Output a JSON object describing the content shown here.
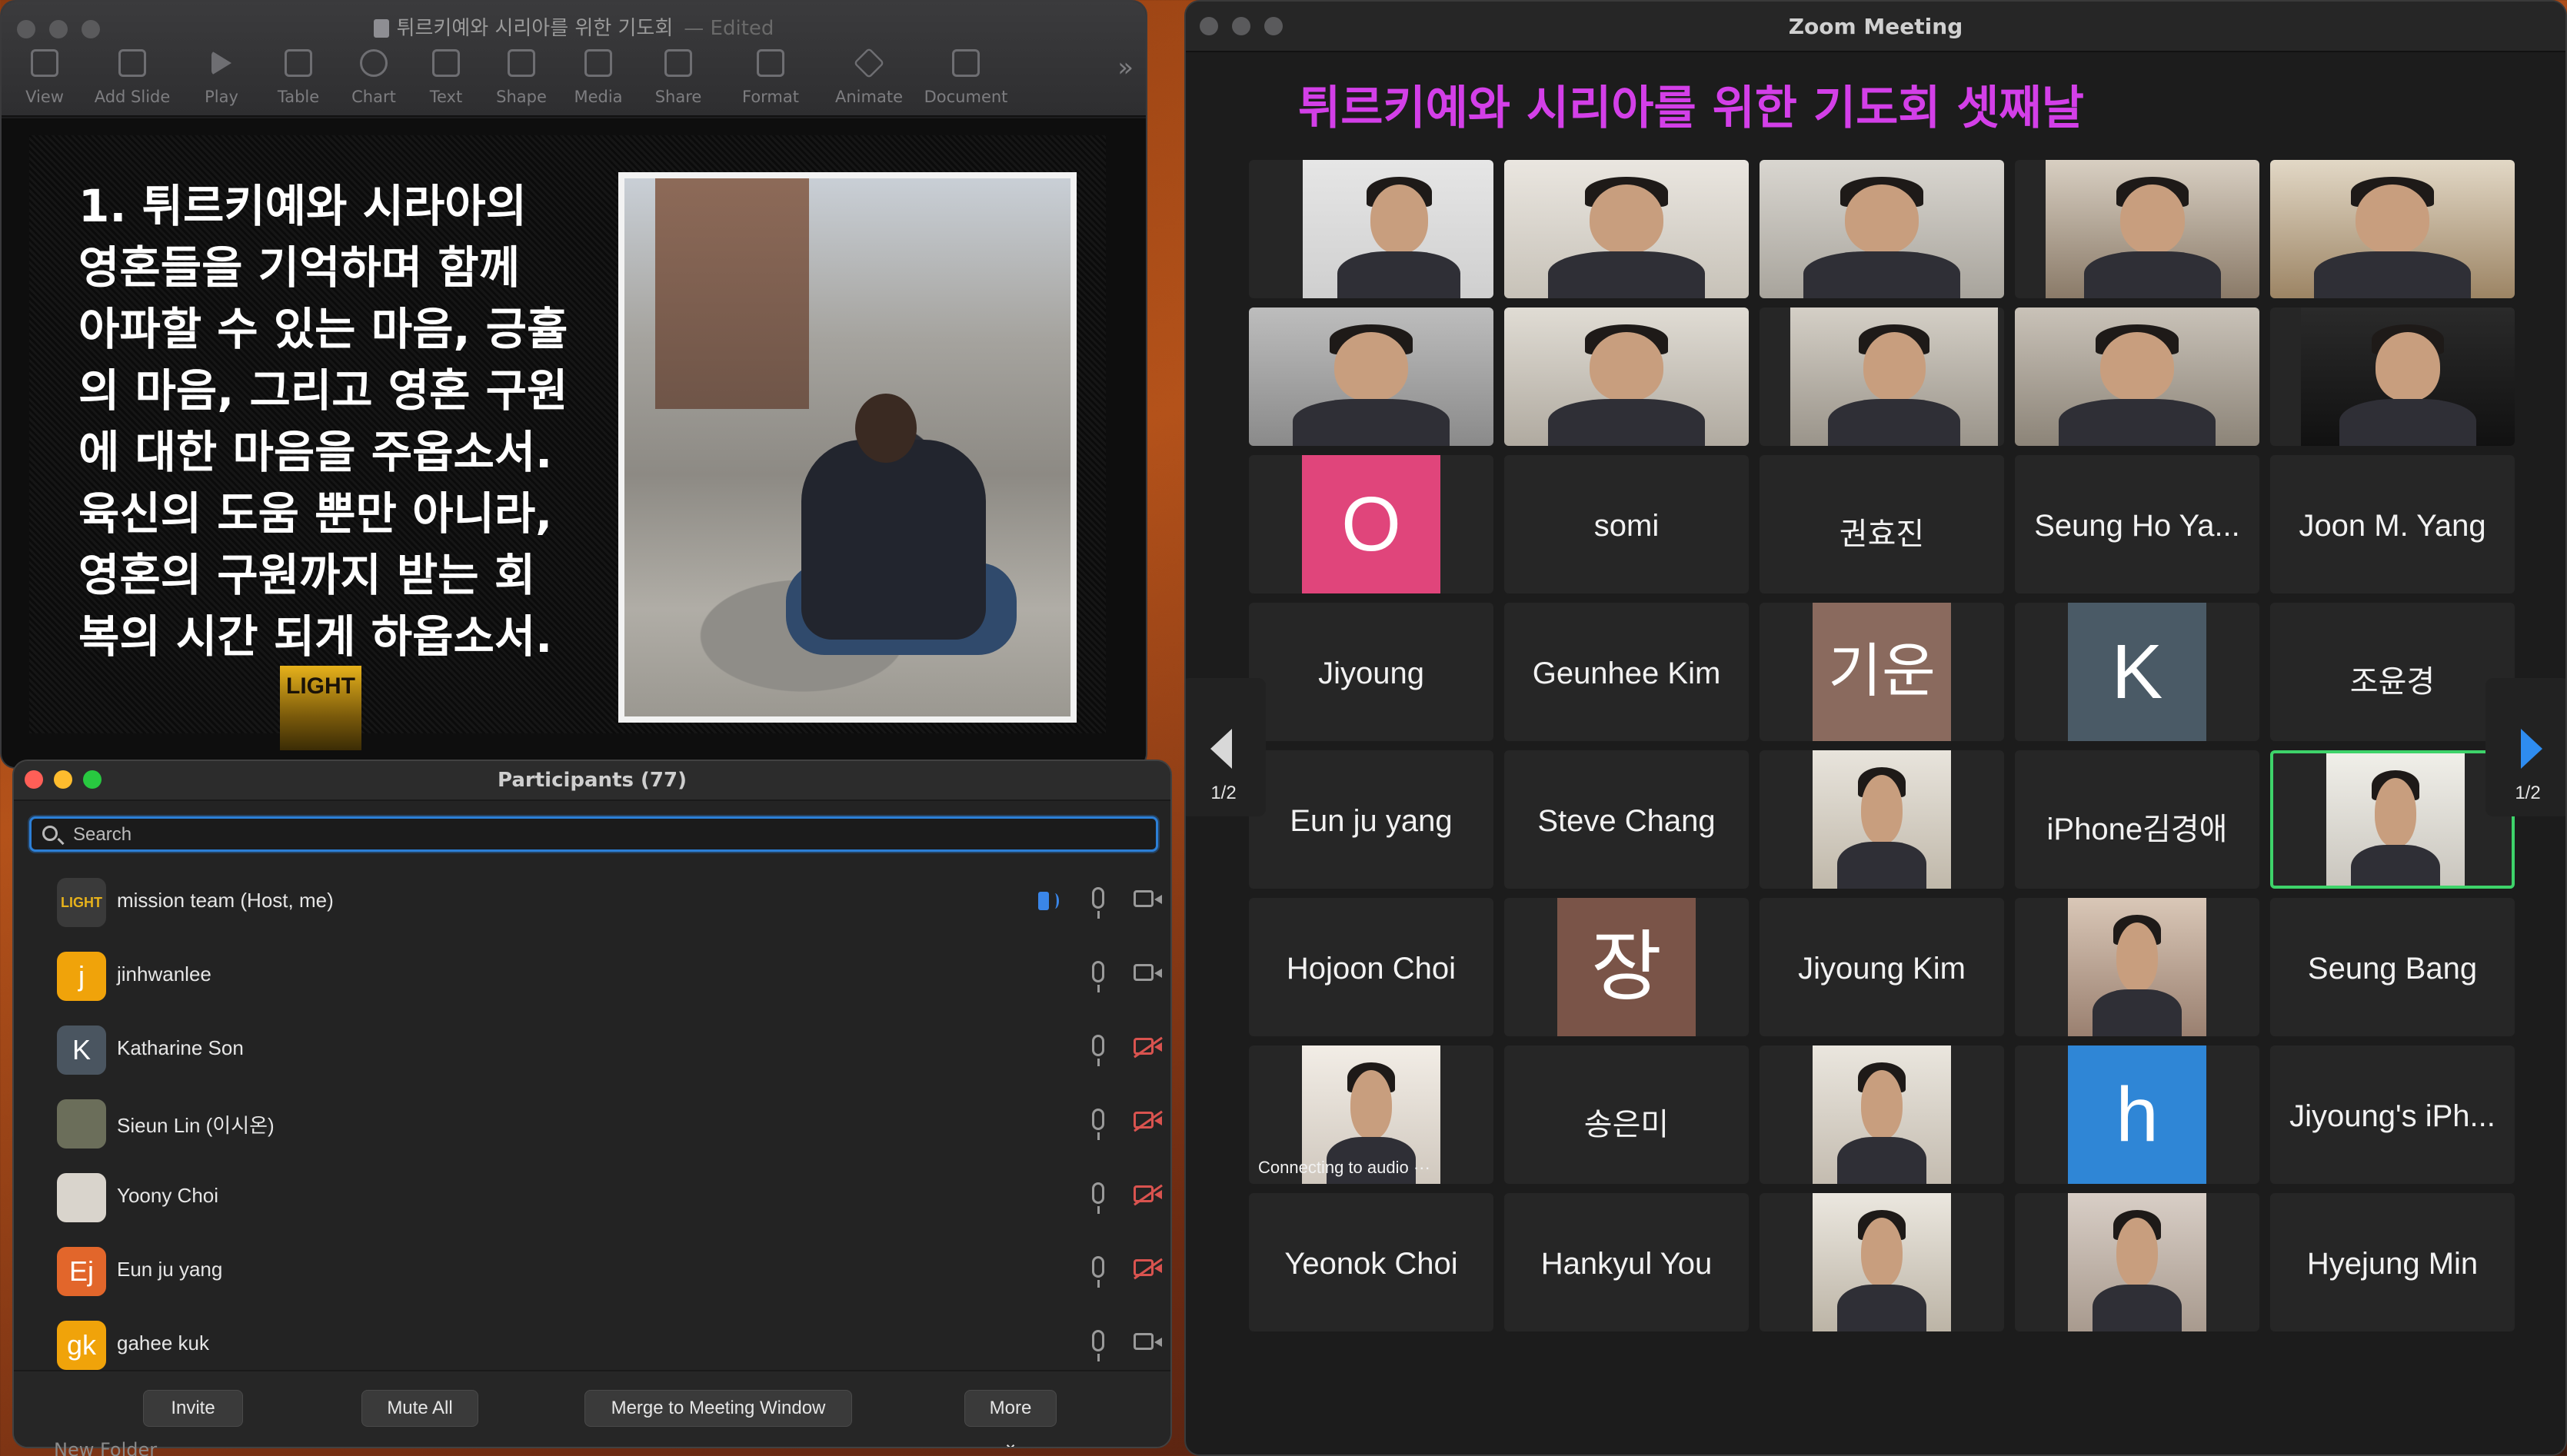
{
  "keynote": {
    "window_title": "튀르키예와 시리아를 위한 기도회",
    "edited_label": "— Edited",
    "toolbar": [
      {
        "label": "View",
        "icon": "sidebar-icon"
      },
      {
        "label": "Add Slide",
        "icon": "add-slide-icon"
      },
      {
        "label": "Play",
        "icon": "play-icon"
      },
      {
        "label": "Table",
        "icon": "table-icon"
      },
      {
        "label": "Chart",
        "icon": "chart-icon"
      },
      {
        "label": "Text",
        "icon": "text-icon"
      },
      {
        "label": "Shape",
        "icon": "shape-icon"
      },
      {
        "label": "Media",
        "icon": "media-icon"
      },
      {
        "label": "Share",
        "icon": "share-icon"
      },
      {
        "label": "Format",
        "icon": "format-icon"
      },
      {
        "label": "Animate",
        "icon": "animate-icon"
      },
      {
        "label": "Document",
        "icon": "document-icon"
      }
    ],
    "overflow_label": "»",
    "slide": {
      "lines": [
        "1. 튀르키예와 시라아의",
        "영혼들을 기억하며 함께",
        "아파할 수 있는 마음, 긍휼",
        "의 마음, 그리고 영혼 구원",
        "에 대한 마음을 주옵소서.",
        "육신의 도움 뿐만 아니라,",
        "영혼의 구원까지 받는 회",
        "복의 시간 되게 하옵소서."
      ],
      "logo_text": "LIGHT"
    }
  },
  "participants_panel": {
    "title": "Participants (77)",
    "search_placeholder": "Search",
    "rows": [
      {
        "name": "mission team (Host, me)",
        "avatar": "LIGHT",
        "avatar_color": "#3a3a3a",
        "audio_active": true,
        "video_off": false
      },
      {
        "name": "jinhwanlee",
        "avatar": "j",
        "avatar_color": "#f0a30a",
        "audio_active": false,
        "video_off": false
      },
      {
        "name": "Katharine Son",
        "avatar": "K",
        "avatar_color": "#4a5560",
        "audio_active": false,
        "video_off": true
      },
      {
        "name": "Sieun Lin (이시온)",
        "avatar": "",
        "avatar_color": "#6b6e5a",
        "audio_active": false,
        "video_off": true
      },
      {
        "name": "Yoony Choi",
        "avatar": "",
        "avatar_color": "#d9d4cc",
        "audio_active": false,
        "video_off": true
      },
      {
        "name": "Eun ju yang",
        "avatar": "Ej",
        "avatar_color": "#e2662b",
        "audio_active": false,
        "video_off": true
      },
      {
        "name": "gahee kuk",
        "avatar": "gk",
        "avatar_color": "#f0a30a",
        "audio_active": false,
        "video_off": false
      }
    ],
    "buttons": {
      "invite": "Invite",
      "mute_all": "Mute All",
      "merge": "Merge to Meeting Window",
      "more": "More ⌄"
    }
  },
  "desktop": {
    "folder_label": "New Folder"
  },
  "zoom": {
    "window_title": "Zoom Meeting",
    "heading": "튀르키예와 시리아를 위한 기도회 셋째날",
    "page_left": "1/2",
    "page_right": "1/2",
    "colors": {
      "accent_blue": "#2e8cf0",
      "active_speaker": "#3ed36a",
      "heading": "#d33fe8"
    },
    "tiles": [
      {
        "type": "video",
        "name": ""
      },
      {
        "type": "video",
        "name": ""
      },
      {
        "type": "video",
        "name": ""
      },
      {
        "type": "video",
        "name": ""
      },
      {
        "type": "video",
        "name": ""
      },
      {
        "type": "video",
        "name": ""
      },
      {
        "type": "video",
        "name": ""
      },
      {
        "type": "video",
        "name": ""
      },
      {
        "type": "video",
        "name": ""
      },
      {
        "type": "video",
        "name": ""
      },
      {
        "type": "avatar",
        "letter": "O",
        "color": "#e0457b"
      },
      {
        "type": "name",
        "name": "somi"
      },
      {
        "type": "name",
        "name": "권효진"
      },
      {
        "type": "name",
        "name": "Seung Ho Ya..."
      },
      {
        "type": "name",
        "name": "Joon M. Yang"
      },
      {
        "type": "name",
        "name": "Jiyoung"
      },
      {
        "type": "name",
        "name": "Geunhee Kim"
      },
      {
        "type": "avatar",
        "letter": "기운",
        "color": "#8a6a5e"
      },
      {
        "type": "avatar",
        "letter": "K",
        "color": "#4a5a66"
      },
      {
        "type": "name",
        "name": "조윤경"
      },
      {
        "type": "name",
        "name": "Eun ju yang"
      },
      {
        "type": "name",
        "name": "Steve Chang"
      },
      {
        "type": "video",
        "name": ""
      },
      {
        "type": "name",
        "name": "iPhone김경애"
      },
      {
        "type": "video",
        "name": "",
        "active": true
      },
      {
        "type": "name",
        "name": "Hojoon Choi"
      },
      {
        "type": "avatar",
        "letter": "장",
        "color": "#7a5448"
      },
      {
        "type": "name",
        "name": "Jiyoung Kim"
      },
      {
        "type": "video",
        "name": ""
      },
      {
        "type": "name",
        "name": "Seung Bang"
      },
      {
        "type": "video",
        "name": "",
        "status": "Connecting to audio  ···"
      },
      {
        "type": "name",
        "name": "송은미"
      },
      {
        "type": "video",
        "name": ""
      },
      {
        "type": "avatar",
        "letter": "h",
        "color": "#2f86d6"
      },
      {
        "type": "name",
        "name": "Jiyoung's iPh..."
      },
      {
        "type": "name",
        "name": "Yeonok Choi"
      },
      {
        "type": "name",
        "name": "Hankyul You"
      },
      {
        "type": "video",
        "name": ""
      },
      {
        "type": "video",
        "name": ""
      },
      {
        "type": "name",
        "name": "Hyejung Min"
      }
    ]
  }
}
